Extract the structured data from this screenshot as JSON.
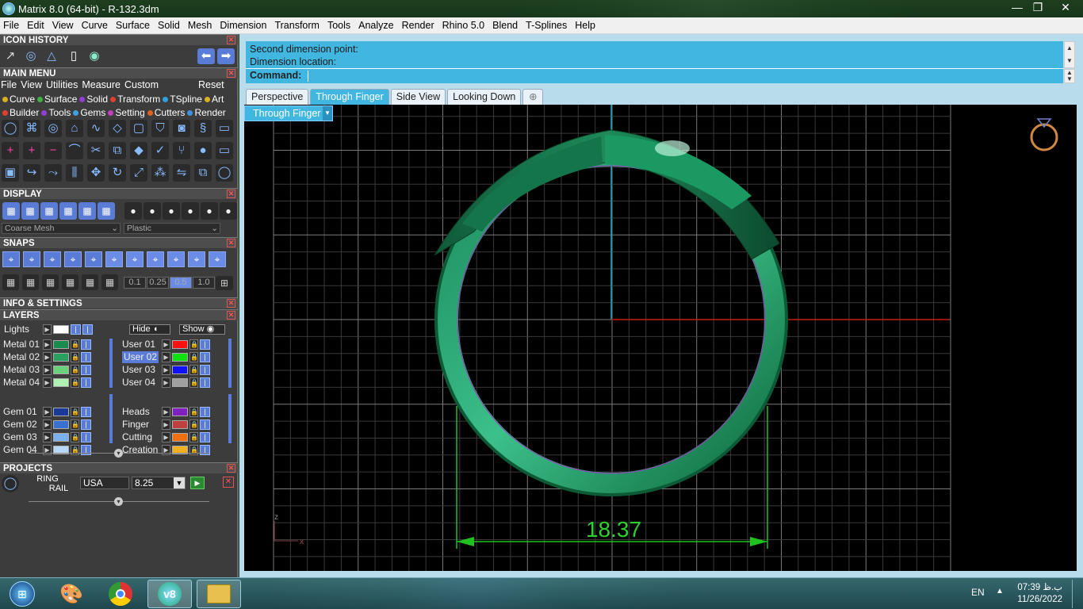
{
  "window": {
    "title": "Matrix 8.0 (64-bit) - R-132.3dm",
    "min": "—",
    "max": "❐",
    "close": "✕"
  },
  "menubar": [
    "File",
    "Edit",
    "View",
    "Curve",
    "Surface",
    "Solid",
    "Mesh",
    "Dimension",
    "Transform",
    "Tools",
    "Analyze",
    "Render",
    "Rhino 5.0",
    "Blend",
    "T-Splines",
    "Help"
  ],
  "panel": {
    "icon_history": "ICON HISTORY",
    "main_menu": "MAIN MENU",
    "main_menu_items": [
      "File",
      "View",
      "Utilities",
      "Measure",
      "Custom"
    ],
    "reset": "Reset",
    "cat_row1": [
      {
        "label": "Curve",
        "color": "#d8b020"
      },
      {
        "label": "Surface",
        "color": "#40b040"
      },
      {
        "label": "Solid",
        "color": "#9040d0"
      },
      {
        "label": "Transform",
        "color": "#e04030"
      },
      {
        "label": "TSpline",
        "color": "#30a0e0"
      },
      {
        "label": "Art",
        "color": "#d8b020"
      }
    ],
    "cat_row2": [
      {
        "label": "Builder",
        "color": "#e04030"
      },
      {
        "label": "Tools",
        "color": "#9040d0"
      },
      {
        "label": "Gems",
        "color": "#40a0e0"
      },
      {
        "label": "Setting",
        "color": "#c040c0"
      },
      {
        "label": "Cutters",
        "color": "#e06020"
      },
      {
        "label": "Render",
        "color": "#4090e0"
      }
    ],
    "display": "DISPLAY",
    "display_mesh": "Coarse Mesh",
    "display_material": "Plastic",
    "snaps": "SNAPS",
    "snap_values": [
      "0.1",
      "0.25",
      "0.5",
      "1.0"
    ],
    "info_settings": "INFO & SETTINGS",
    "layers": "LAYERS",
    "lights": "Lights",
    "hide": "Hide",
    "show": "Show",
    "layers_left": [
      {
        "name": "Metal 01",
        "color": "#1a8a50"
      },
      {
        "name": "Metal 02",
        "color": "#2aa060"
      },
      {
        "name": "Metal 03",
        "color": "#6ad07a"
      },
      {
        "name": "Metal 04",
        "color": "#b0f0b0"
      },
      {
        "name": "Gem 01",
        "color": "#1a3a9a"
      },
      {
        "name": "Gem 02",
        "color": "#3a70d0"
      },
      {
        "name": "Gem 03",
        "color": "#7ab0f0"
      },
      {
        "name": "Gem 04",
        "color": "#b8d8f8"
      }
    ],
    "layers_right": [
      {
        "name": "User 01",
        "color": "#ff1010"
      },
      {
        "name": "User 02",
        "color": "#10e010"
      },
      {
        "name": "User 03",
        "color": "#1010ff"
      },
      {
        "name": "User 04",
        "color": "#a0a0a0"
      },
      {
        "name": "Heads",
        "color": "#8020c0"
      },
      {
        "name": "Finger",
        "color": "#c04040"
      },
      {
        "name": "Cutting",
        "color": "#f07010"
      },
      {
        "name": "Creation",
        "color": "#f0b020"
      }
    ],
    "projects": "PROJECTS",
    "project_name_1": "RING",
    "project_name_2": "RAIL",
    "ring_standard": "USA",
    "ring_size": "8.25"
  },
  "command": {
    "line1": "Second dimension point:",
    "line2": "Dimension location:",
    "prompt": "Command:"
  },
  "tabs": [
    "Perspective",
    "Through Finger",
    "Side View",
    "Looking Down"
  ],
  "active_tab": "Through Finger",
  "viewport": {
    "label": "Through Finger",
    "dimension": "18.37",
    "axis_z": "z",
    "axis_x": "x"
  },
  "taskbar": {
    "lang": "EN",
    "time": "07:39 ب.ظ",
    "date": "11/26/2022"
  }
}
